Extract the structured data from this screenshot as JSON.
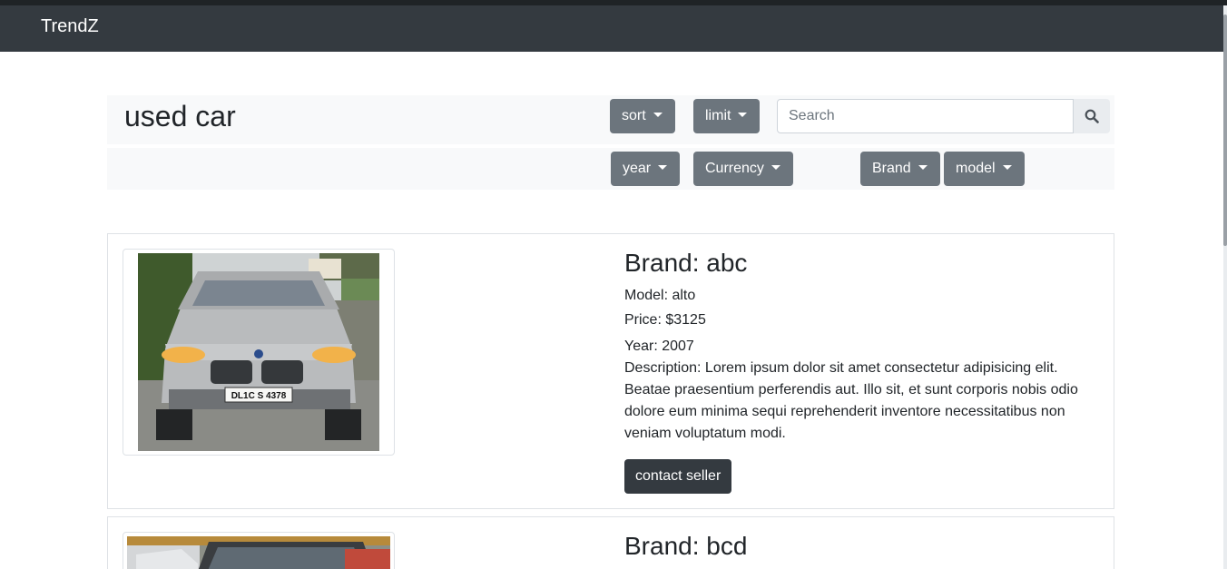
{
  "navbar": {
    "brand": "TrendZ"
  },
  "page": {
    "title": "used car"
  },
  "filters": {
    "sort": "sort",
    "limit": "limit",
    "year": "year",
    "currency": "Currency",
    "brand": "Brand",
    "model": "model"
  },
  "search": {
    "placeholder": "Search",
    "value": ""
  },
  "icons": {
    "search": "search-icon",
    "dropdown": "caret-down-icon"
  },
  "colors": {
    "navbar": "#343a40",
    "filter_button": "#6c757d",
    "contact_button": "#343a40",
    "panel": "#f8f9fa"
  },
  "cars": [
    {
      "brand": "Brand: abc",
      "model": "Model: alto",
      "price": "Price: $3125",
      "year": "Year: 2007",
      "description": "Description: Lorem ipsum dolor sit amet consectetur adipisicing elit. Beatae praesentium perferendis aut. Illo sit, et sunt corporis nobis odio dolore eum minima sequi reprehenderit inventore necessitatibus non veniam voluptatum modi.",
      "contact": "contact seller",
      "plate": "DL1C S 4378"
    },
    {
      "brand": "Brand: bcd"
    }
  ]
}
